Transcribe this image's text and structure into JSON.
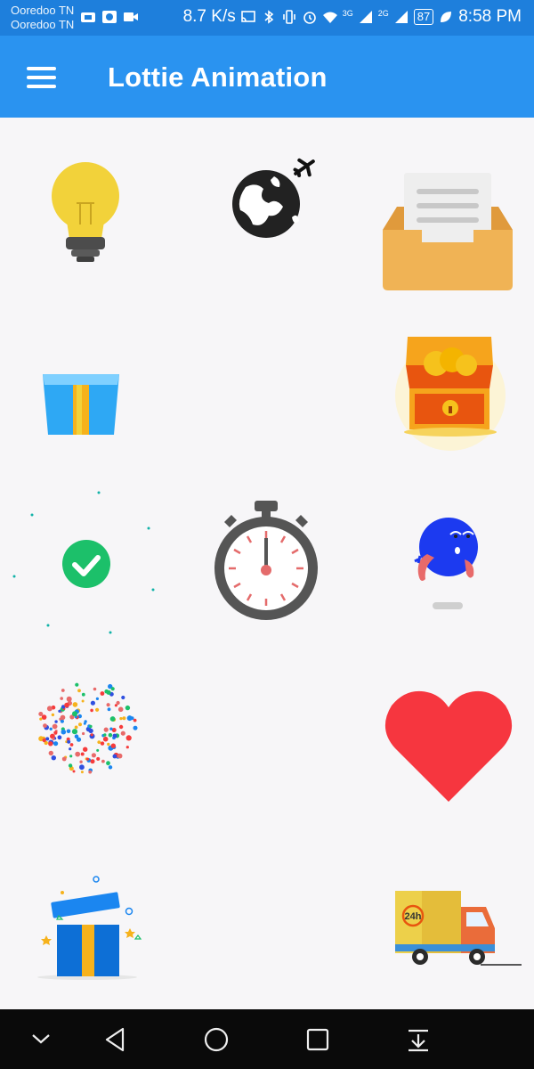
{
  "status_bar": {
    "carrier_1": "Ooredoo TN",
    "carrier_2": "Ooredoo TN",
    "speed": "8.7 K/s",
    "net_1": "3G",
    "net_2": "2G",
    "battery": "87",
    "time": "8:58 PM"
  },
  "app_bar": {
    "title": "Lottie Animation"
  },
  "grid": {
    "items": [
      "lightbulb",
      "globe-airplane",
      "inbox-document",
      "gift-box",
      "",
      "treasure-chest",
      "success-check",
      "stopwatch",
      "blue-monster",
      "confetti",
      "",
      "heart",
      "gift-open",
      "",
      "delivery-truck-24h"
    ]
  },
  "colors": {
    "status_bar": "#1e7fdc",
    "app_bar": "#2a93f0",
    "background": "#f7f6f8",
    "nav_bar": "#0a0a0a"
  }
}
